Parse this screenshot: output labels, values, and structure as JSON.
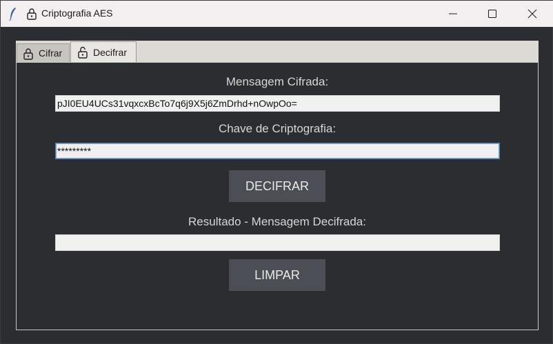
{
  "window": {
    "title": "Criptografia AES"
  },
  "tabs": [
    {
      "label": "Cifrar"
    },
    {
      "label": "Decifrar"
    }
  ],
  "form": {
    "cipher_label": "Mensagem Cifrada:",
    "cipher_value": "pJI0EU4UCs31vqxcxBcTo7q6j9X5j6ZmDrhd+nOwpOo=",
    "key_label": "Chave de Criptografia:",
    "key_value": "*********",
    "decrypt_button": "DECIFRAR",
    "result_label": "Resultado - Mensagem Decifrada:",
    "result_value": "",
    "clear_button": "LIMPAR"
  }
}
